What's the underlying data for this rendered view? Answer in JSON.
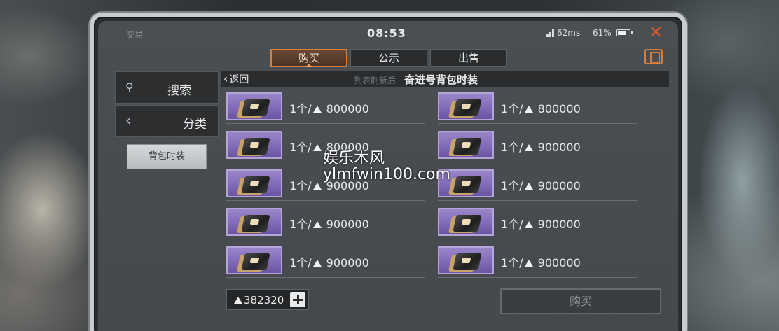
{
  "status": {
    "app_name": "交易",
    "time": "08:53",
    "ping": "62ms",
    "battery": "61%"
  },
  "tabs": [
    {
      "label": "购买",
      "active": true
    },
    {
      "label": "公示",
      "active": false
    },
    {
      "label": "出售",
      "active": false
    }
  ],
  "sidebar": {
    "search_label": "搜索",
    "category_label": "分类",
    "selected_category": "背包时装"
  },
  "header": {
    "back_label": "返回",
    "ghost_text": "列表刷新后",
    "title": "奋进号背包时装"
  },
  "listings": [
    {
      "qty": "1个/",
      "price": "800000"
    },
    {
      "qty": "1个/",
      "price": "800000"
    },
    {
      "qty": "1个/",
      "price": "800000"
    },
    {
      "qty": "1个/",
      "price": "900000"
    },
    {
      "qty": "1个/",
      "price": "900000"
    },
    {
      "qty": "1个/",
      "price": "900000"
    },
    {
      "qty": "1个/",
      "price": "900000"
    },
    {
      "qty": "1个/",
      "price": "900000"
    },
    {
      "qty": "1个/",
      "price": "900000"
    },
    {
      "qty": "1个/",
      "price": "900000"
    }
  ],
  "footer": {
    "balance": "382320",
    "buy_label": "购买"
  },
  "watermark": {
    "line1": "娱乐木风",
    "line2": "ylmfwin100.com"
  },
  "colors": {
    "accent": "#d47f3c",
    "item_bg": "#8a74bf",
    "close": "#d45a2c"
  }
}
